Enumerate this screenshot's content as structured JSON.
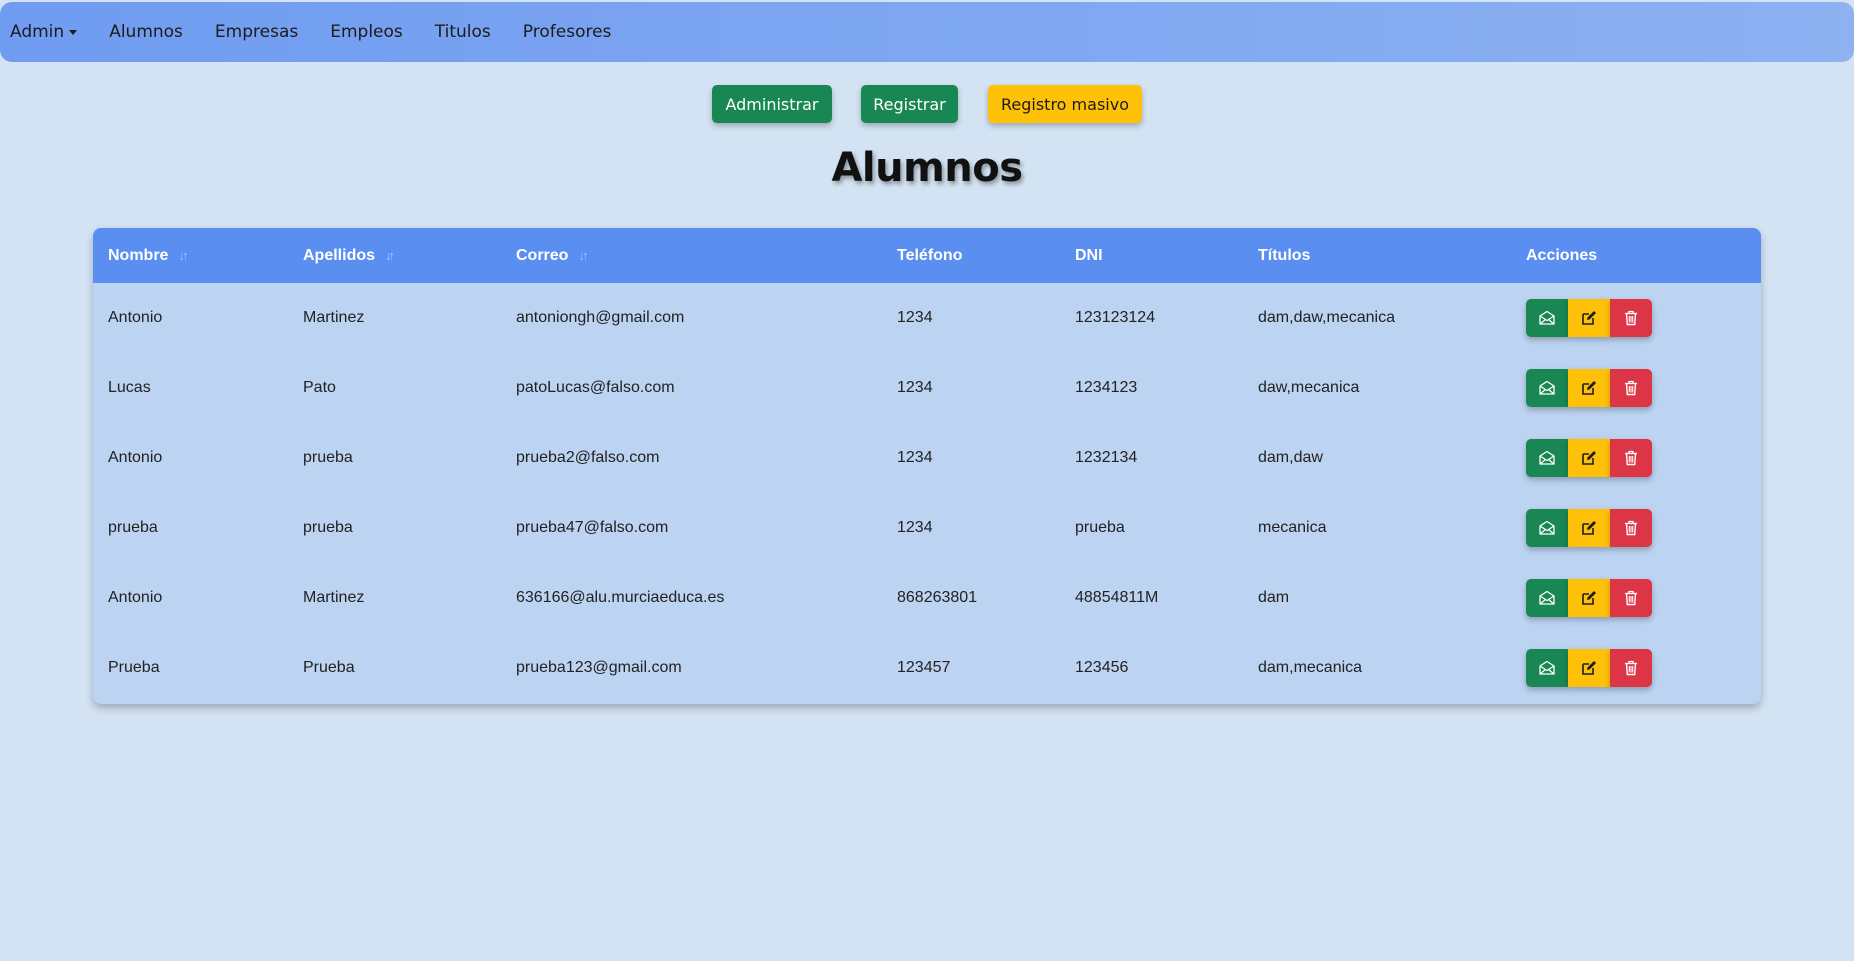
{
  "nav": {
    "items": [
      {
        "label": "Admin",
        "dropdown": true
      },
      {
        "label": "Alumnos"
      },
      {
        "label": "Empresas"
      },
      {
        "label": "Empleos"
      },
      {
        "label": "Titulos"
      },
      {
        "label": "Profesores"
      }
    ]
  },
  "actions": {
    "administrar": "Administrar",
    "registrar": "Registrar",
    "registro_masivo": "Registro masivo"
  },
  "page": {
    "title": "Alumnos"
  },
  "table": {
    "columns": [
      "Nombre",
      "Apellidos",
      "Correo",
      "Teléfono",
      "DNI",
      "Títulos",
      "Acciones"
    ],
    "rows": [
      [
        "Antonio",
        "Martinez",
        "antoniongh@gmail.com",
        "1234",
        "123123124",
        "dam,daw,mecanica"
      ],
      [
        "Lucas",
        "Pato",
        "patoLucas@falso.com",
        "1234",
        "1234123",
        "daw,mecanica"
      ],
      [
        "Antonio",
        "prueba",
        "prueba2@falso.com",
        "1234",
        "1232134",
        "dam,daw"
      ],
      [
        "prueba",
        "prueba",
        "prueba47@falso.com",
        "1234",
        "prueba",
        "mecanica"
      ],
      [
        "Antonio",
        "Martinez",
        "636166@alu.murciaeduca.es",
        "868263801",
        "48854811M",
        "dam"
      ],
      [
        "Prueba",
        "Prueba",
        "prueba123@gmail.com",
        "123457",
        "123456",
        "dam,mecanica"
      ]
    ],
    "row_actions": [
      "envelope-icon",
      "edit-icon",
      "trash-icon"
    ]
  },
  "colors": {
    "navbar": "#6f9cf1",
    "header": "#5a8ef1",
    "green": "#198754",
    "yellow": "#ffc107",
    "red": "#dc3545",
    "background": "#d3e3f3"
  }
}
